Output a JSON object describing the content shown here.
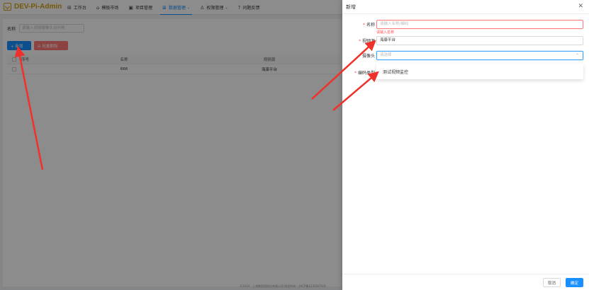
{
  "app": {
    "logo_text": "DEV-Pi-Admin",
    "brand_color": "#d4a017",
    "accent_color": "#1890ff"
  },
  "nav": [
    {
      "label": "工作台",
      "icon": "dashboard-icon",
      "glyph": "⊞"
    },
    {
      "label": "模板市场",
      "icon": "shop-icon",
      "glyph": "⌂"
    },
    {
      "label": "项目管理",
      "icon": "project-icon",
      "glyph": "▣"
    },
    {
      "label": "数据管理",
      "icon": "database-icon",
      "glyph": "≣",
      "active": true,
      "caret": "⌄"
    },
    {
      "label": "权限管理",
      "icon": "user-icon",
      "glyph": "♙",
      "caret": "⌄"
    },
    {
      "label": "问题反馈",
      "icon": "question-icon",
      "glyph": "?"
    }
  ],
  "search": {
    "label": "名称",
    "placeholder": "请输入视频摄像头访问地"
  },
  "toolbar": {
    "add_label": "+ 新增",
    "batch_delete_label": "⊟ 批量删除"
  },
  "table": {
    "columns": [
      "序号",
      "名称",
      "视频源"
    ],
    "rows": [
      {
        "index": "1",
        "name": "666",
        "source": "海康平台"
      }
    ]
  },
  "footer_text": "©2024 · 上海数智园科技有限公司 版权所有 · 沪ICP备12345678号",
  "drawer": {
    "title": "新增",
    "close_glyph": "✕",
    "fields": {
      "name": {
        "label": "名称",
        "placeholder": "请输入名称/编码",
        "error": "请输入名称"
      },
      "video_source": {
        "label": "视频源",
        "value": "海康平台"
      },
      "camera": {
        "label": "摄像头",
        "placeholder": "请选择",
        "chevron": "⌃"
      },
      "encoding": {
        "label": "编码类型"
      }
    },
    "dropdown_options": [
      "测试视频监控"
    ],
    "cancel_label": "取消",
    "ok_label": "确定"
  }
}
